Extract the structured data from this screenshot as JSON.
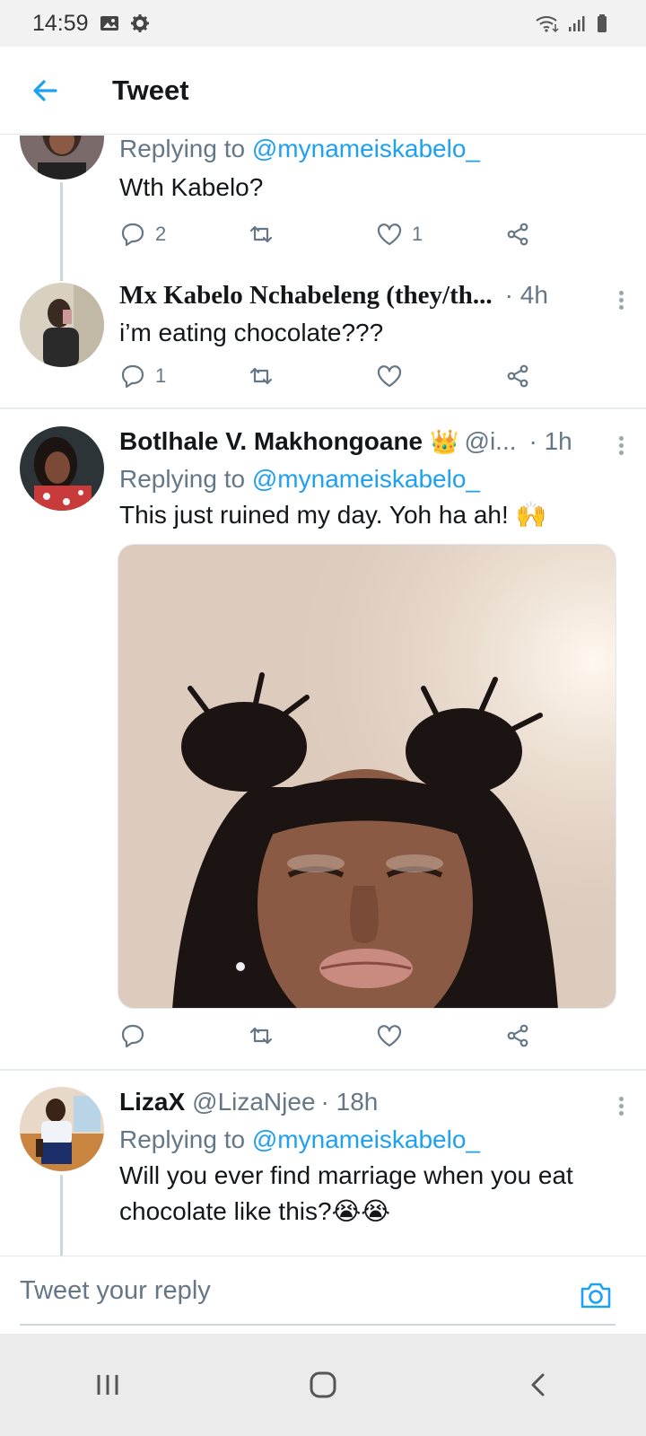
{
  "status_bar": {
    "time": "14:59",
    "icons": [
      "image-icon",
      "gear-icon",
      "wifi-icon",
      "signal-icon",
      "battery-icon"
    ]
  },
  "header": {
    "title": "Tweet",
    "back_icon": "back-arrow-icon"
  },
  "colors": {
    "accent": "#1da1f2",
    "secondary_text": "#657786",
    "divider": "#e6ecf0"
  },
  "tweets": [
    {
      "replying_label": "Replying to",
      "replying_to": "@mynameiskabelo_",
      "text": "Wth Kabelo?",
      "reply_count": "2",
      "retweet_count": "",
      "like_count": "1"
    },
    {
      "name": "Mx Kabelo Nchabeleng (they/th...",
      "time": "· 4h",
      "text": "i’m eating chocolate???",
      "reply_count": "1",
      "retweet_count": "",
      "like_count": ""
    },
    {
      "name": "Botlhale V. Makhongoane",
      "name_emoji": "👑",
      "handle": "@i...",
      "time": "· 1h",
      "replying_label": "Replying to",
      "replying_to": "@mynameiskabelo_",
      "text": "This just ruined my day. Yoh ha ah! 🙌",
      "media": "photo",
      "reply_count": "",
      "retweet_count": "",
      "like_count": ""
    },
    {
      "name": "LizaX",
      "handle": "@LizaNjee",
      "time": "· 18h",
      "replying_label": "Replying to",
      "replying_to": "@mynameiskabelo_",
      "text": "Will you ever find marriage when you eat chocolate like this?😭😭"
    }
  ],
  "reply_bar": {
    "placeholder": "Tweet your reply",
    "camera_icon": "camera-icon"
  },
  "nav_bar": {
    "icons": [
      "recents-icon",
      "home-icon",
      "back-icon"
    ]
  }
}
